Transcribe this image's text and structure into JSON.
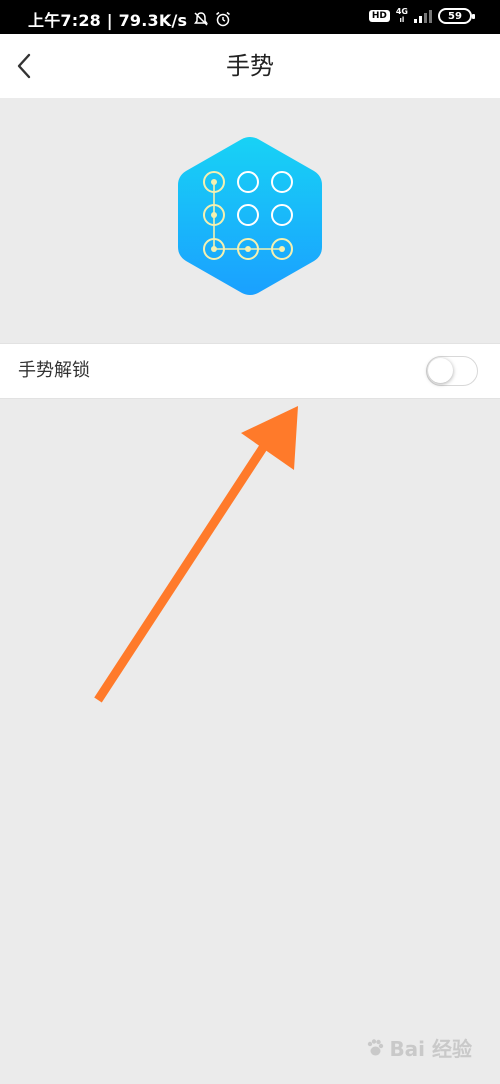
{
  "status_bar": {
    "time_speed": "上午7:28 | 79.3K/s",
    "hd": "HD",
    "network": "4G",
    "battery": "59"
  },
  "header": {
    "title": "手势"
  },
  "settings": {
    "gesture_unlock_label": "手势解锁",
    "gesture_unlock_enabled": false
  },
  "watermark": {
    "text": "Bai  经验"
  },
  "colors": {
    "hex_top": "#18d2f5",
    "hex_bottom": "#1aa0ff",
    "pattern_line": "#f4f0b0",
    "arrow": "#ff7a2a",
    "background": "#ebebeb"
  },
  "icons": [
    "back-chevron-icon",
    "gesture-pattern-icon",
    "mute-icon",
    "alarm-icon",
    "signal-icon"
  ]
}
